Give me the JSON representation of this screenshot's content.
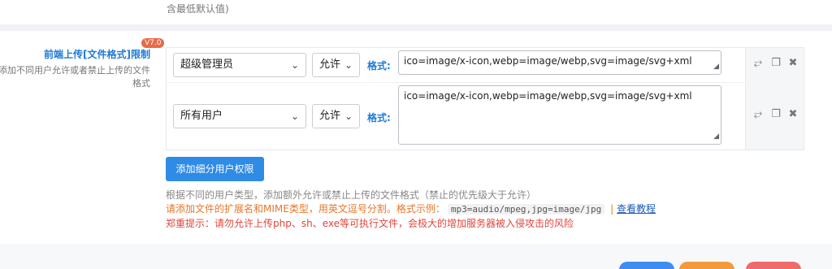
{
  "top_note": "含最低默认值)",
  "section": {
    "title": "前端上传[文件格式]限制",
    "version_badge": "V7.0",
    "description": "添加不同用户允许或者禁止上传的文件格式"
  },
  "rules": [
    {
      "role": "超级管理员",
      "permission": "允许",
      "format_label": "格式:",
      "format_value": "ico=image/x-icon,webp=image/webp,svg=image/svg+xml"
    },
    {
      "role": "所有用户",
      "permission": "允许",
      "format_label": "格式:",
      "format_value": "ico=image/x-icon,webp=image/webp,svg=image/svg+xml"
    }
  ],
  "actions": {
    "expand_icon": "expand-icon",
    "copy_icon": "copy-icon",
    "delete_icon": "close-icon"
  },
  "add_button": "添加细分用户权限",
  "help": {
    "line1": "根据不同的用户类型，添加额外允许或禁止上传的文件格式（禁止的优先级大于允许）",
    "line2_prefix": "请添加文件的扩展名和MIME类型，用英文逗号分割。格式示例：",
    "line2_code": "mp3=audio/mpeg,jpg=image/jpg",
    "line2_sep": "|",
    "line2_link": "查看教程",
    "line3": "郑重提示：请勿允许上传php、sh、exe等可执行文件，会极大的增加服务器被入侵攻击的风险"
  },
  "colors": {
    "accent": "#1e7ad6",
    "button": "#2e8be6",
    "warning": "#e8762a",
    "danger": "#e0463c",
    "bottom_blue": "#3d8ef0",
    "bottom_orange": "#f29a3c",
    "bottom_red": "#f06b6b"
  }
}
